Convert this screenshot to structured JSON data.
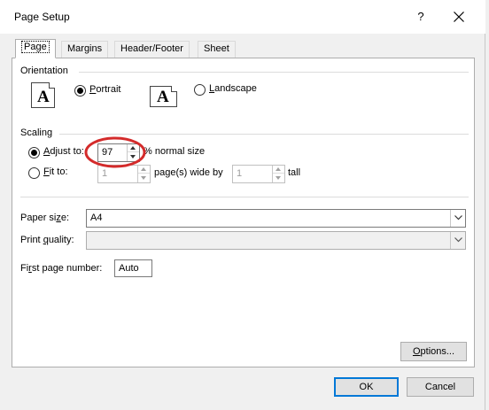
{
  "window": {
    "title": "Page Setup",
    "help_label": "?"
  },
  "tabs": [
    {
      "label": "Page",
      "active": true
    },
    {
      "label": "Margins",
      "active": false
    },
    {
      "label": "Header/Footer",
      "active": false
    },
    {
      "label": "Sheet",
      "active": false
    }
  ],
  "orientation": {
    "group_label": "Orientation",
    "icon_glyph": "A",
    "portrait": {
      "pre": "",
      "accel": "P",
      "post": "ortrait",
      "checked": true
    },
    "landscape": {
      "pre": "",
      "accel": "L",
      "post": "andscape",
      "checked": false
    }
  },
  "scaling": {
    "group_label": "Scaling",
    "adjust": {
      "pre": "",
      "accel": "A",
      "post": "djust to:",
      "checked": true,
      "value": "97",
      "suffix": "% normal size"
    },
    "fit": {
      "pre": "",
      "accel": "F",
      "post": "it to:",
      "checked": false,
      "wide_value": "1",
      "wide_label": "page(s) wide by",
      "tall_value": "1",
      "tall_label": "tall"
    }
  },
  "paper_size": {
    "pre": "Paper si",
    "accel": "z",
    "post": "e:",
    "value": "A4"
  },
  "print_quality": {
    "pre": "Print ",
    "accel": "q",
    "post": "uality:",
    "value": ""
  },
  "first_page": {
    "pre": "Fi",
    "accel": "r",
    "post": "st page number:",
    "value": "Auto"
  },
  "buttons": {
    "options": {
      "pre": "",
      "accel": "O",
      "post": "ptions..."
    },
    "ok": "OK",
    "cancel": "Cancel"
  },
  "colors": {
    "accent": "#0078d7",
    "annotation": "#d42b2b"
  },
  "icons": [
    "close-icon",
    "chevron-down-icon",
    "spin-up-icon",
    "spin-down-icon"
  ]
}
